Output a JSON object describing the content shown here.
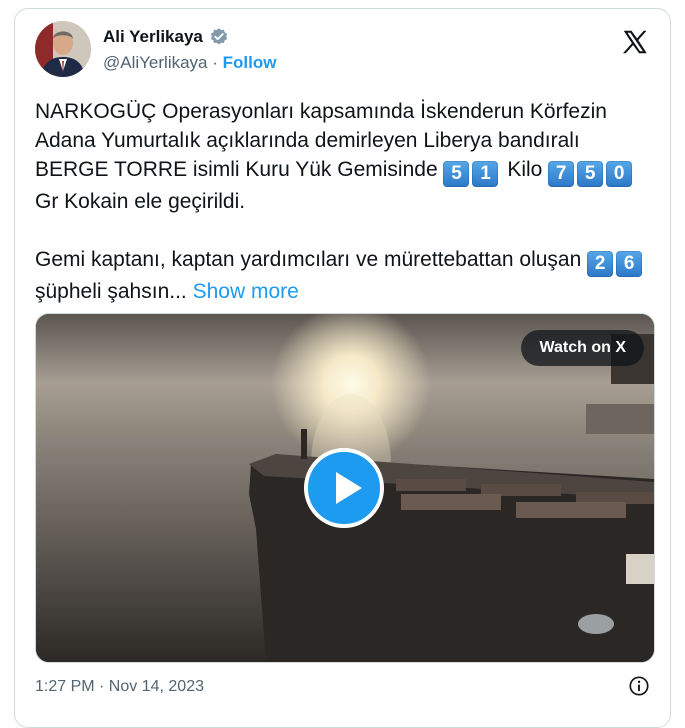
{
  "author": {
    "name": "Ali Yerlikaya",
    "handle": "@AliYerlikaya",
    "separator": "·",
    "follow_label": "Follow"
  },
  "tweet": {
    "p1_a": "NARKOGÜÇ Operasyonları kapsamında İskenderun Körfezin Adana Yumurtalık açıklarında demirleyen Liberya bandıralı BERGE TORRE isimli Kuru Yük Gemisinde",
    "p1_digits_a": [
      "5",
      "1"
    ],
    "p1_b": "Kilo",
    "p1_digits_b": [
      "7",
      "5",
      "0"
    ],
    "p1_c": "Gr Kokain ele geçirildi.",
    "p2_a": "Gemi kaptanı, kaptan yardımcıları ve mürettebattan oluşan",
    "p2_digits": [
      "2",
      "6"
    ],
    "p2_b": "şüpheli şahsın...",
    "show_more": "Show more"
  },
  "media": {
    "watch_label": "Watch on X"
  },
  "footer": {
    "timestamp": "1:27 PM · Nov 14, 2023"
  },
  "colors": {
    "accent": "#1d9bf0",
    "keycap": "#3b8fdb",
    "text": "#0f1419",
    "secondary": "#536471"
  },
  "icons": [
    "verified-badge-icon",
    "x-logo-icon",
    "play-icon",
    "info-icon"
  ]
}
